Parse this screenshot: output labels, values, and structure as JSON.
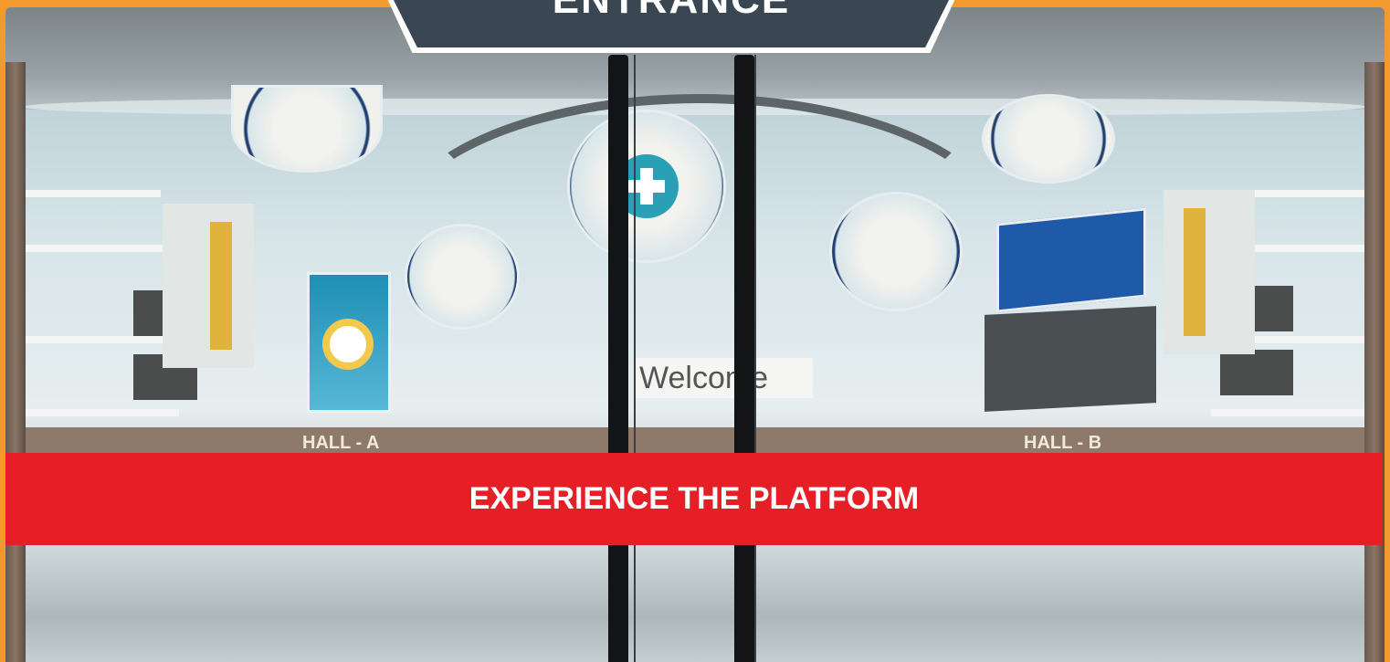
{
  "header": {
    "sign_text": "ENTRANCE"
  },
  "scene": {
    "welcome_text": "Welcome",
    "hall_labels": [
      "HALL - A",
      "HALL - B"
    ]
  },
  "cta": {
    "label": "EXPERIENCE THE PLATFORM"
  },
  "colors": {
    "frame_accent": "#f29a2e",
    "sign_background": "#3a4753",
    "cta_background": "#e61e26",
    "cta_text": "#ffffff"
  },
  "icons": [
    "medical-cross-icon"
  ]
}
